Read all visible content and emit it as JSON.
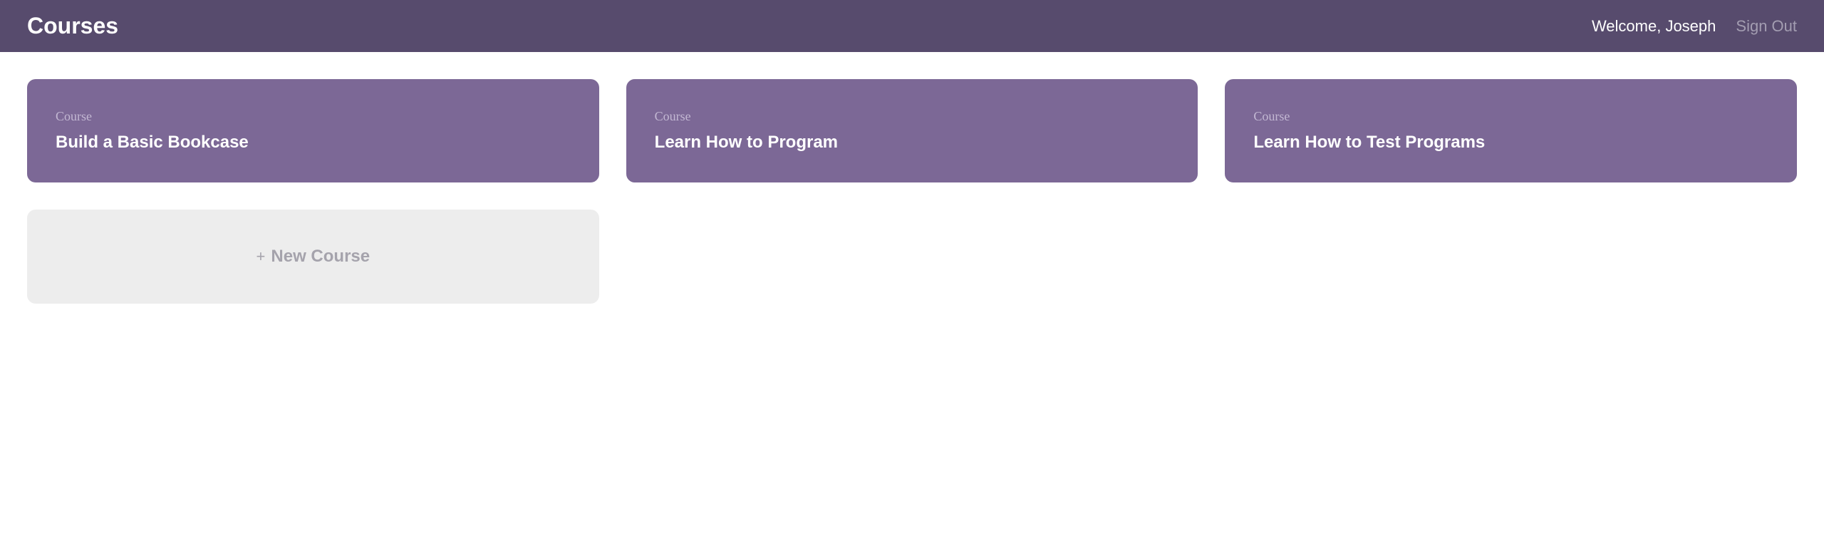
{
  "header": {
    "title": "Courses",
    "welcome": "Welcome, Joseph",
    "signout": "Sign Out"
  },
  "courses": [
    {
      "label": "Course",
      "title": "Build a Basic Bookcase"
    },
    {
      "label": "Course",
      "title": "Learn How to Program"
    },
    {
      "label": "Course",
      "title": "Learn How to Test Programs"
    }
  ],
  "newCourse": {
    "plus": "+",
    "label": "New Course"
  }
}
